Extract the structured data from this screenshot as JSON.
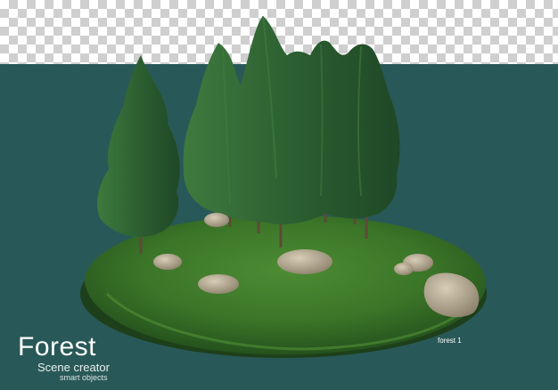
{
  "image": {
    "title": "Forest",
    "subtitle": "Scene creator",
    "tagline": "smart objects",
    "item_label": "forest 1"
  },
  "colors": {
    "background_teal": "#295858",
    "grass": "#3e7a2a",
    "tree": "#2c5a31",
    "rock": "#b8ad95"
  }
}
